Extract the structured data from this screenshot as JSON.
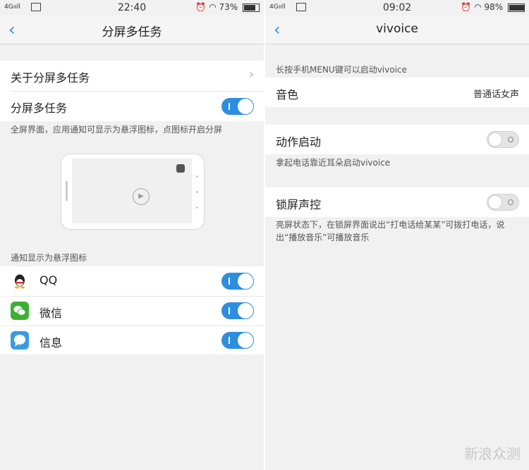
{
  "left": {
    "status": {
      "signal": "4G",
      "time": "22:40",
      "battery": "73%",
      "battery_level": 0.73
    },
    "nav": {
      "back_icon": "chevron-left-icon",
      "title": "分屏多任务"
    },
    "about_label": "关于分屏多任务",
    "split_label": "分屏多任务",
    "split_on": true,
    "split_hint": "全屏界面，应用通知可显示为悬浮图标，点图标开启分屏",
    "notify_header": "通知显示为悬浮图标",
    "apps": [
      {
        "name": "QQ",
        "icon": "qq-icon",
        "color": "#ffffff",
        "on": true
      },
      {
        "name": "微信",
        "icon": "wechat-icon",
        "color": "#3cb034",
        "on": true
      },
      {
        "name": "信息",
        "icon": "message-icon",
        "color": "#3a9be0",
        "on": true
      }
    ]
  },
  "right": {
    "status": {
      "signal": "4G",
      "time": "09:02",
      "battery": "98%",
      "battery_level": 0.98
    },
    "nav": {
      "back_icon": "chevron-left-icon",
      "title": "vivoice"
    },
    "menu_hint": "长按手机MENU键可以启动vivoice",
    "voice_label": "音色",
    "voice_value": "普通话女声",
    "action_label": "动作启动",
    "action_on": false,
    "action_hint": "拿起电话靠近耳朵启动vivoice",
    "lock_label": "锁屏声控",
    "lock_on": false,
    "lock_hint": "亮屏状态下，在锁屏界面说出“打电话给某某”可拨打电话，说出“播放音乐”可播放音乐"
  },
  "watermark": "新浪众测"
}
